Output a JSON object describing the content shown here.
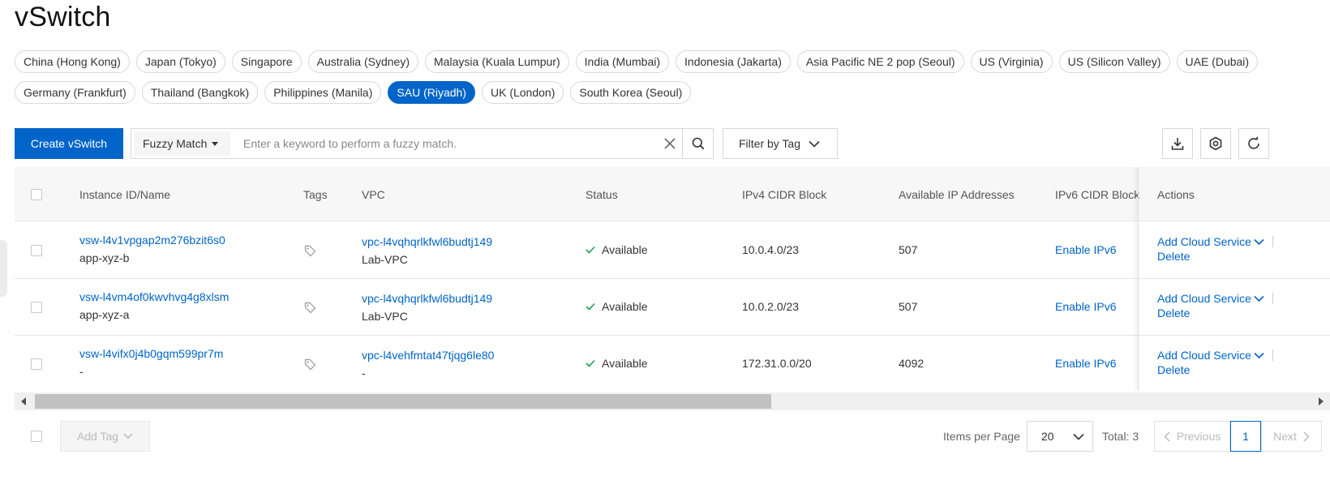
{
  "page": {
    "title": "vSwitch"
  },
  "regions": [
    {
      "label": "China (Hong Kong)",
      "active": false
    },
    {
      "label": "Japan (Tokyo)",
      "active": false
    },
    {
      "label": "Singapore",
      "active": false
    },
    {
      "label": "Australia (Sydney)",
      "active": false
    },
    {
      "label": "Malaysia (Kuala Lumpur)",
      "active": false
    },
    {
      "label": "India (Mumbai)",
      "active": false
    },
    {
      "label": "Indonesia (Jakarta)",
      "active": false
    },
    {
      "label": "Asia Pacific NE 2 pop (Seoul)",
      "active": false
    },
    {
      "label": "US (Virginia)",
      "active": false
    },
    {
      "label": "US (Silicon Valley)",
      "active": false
    },
    {
      "label": "UAE (Dubai)",
      "active": false
    },
    {
      "label": "Germany (Frankfurt)",
      "active": false
    },
    {
      "label": "Thailand (Bangkok)",
      "active": false
    },
    {
      "label": "Philippines (Manila)",
      "active": false
    },
    {
      "label": "SAU (Riyadh)",
      "active": true
    },
    {
      "label": "UK (London)",
      "active": false
    },
    {
      "label": "South Korea (Seoul)",
      "active": false
    }
  ],
  "toolbar": {
    "create_label": "Create vSwitch",
    "match_mode": "Fuzzy Match",
    "search_placeholder": "Enter a keyword to perform a fuzzy match.",
    "filter_tag_label": "Filter by Tag"
  },
  "table": {
    "headers": {
      "instance": "Instance ID/Name",
      "tags": "Tags",
      "vpc": "VPC",
      "status": "Status",
      "ipv4": "IPv4 CIDR Block",
      "available_ips": "Available IP Addresses",
      "ipv6": "IPv6 CIDR Block",
      "actions": "Actions"
    },
    "rows": [
      {
        "id": "vsw-l4v1vpgap2m276bzit6s0",
        "name": "app-xyz-b",
        "vpc_id": "vpc-l4vqhqrlkfwl6budtj149",
        "vpc_name": "Lab-VPC",
        "status": "Available",
        "ipv4": "10.0.4.0/23",
        "available": "507",
        "ipv6": "Enable IPv6",
        "action_add": "Add Cloud Service",
        "action_delete": "Delete"
      },
      {
        "id": "vsw-l4vm4of0kwvhvg4g8xlsm",
        "name": "app-xyz-a",
        "vpc_id": "vpc-l4vqhqrlkfwl6budtj149",
        "vpc_name": "Lab-VPC",
        "status": "Available",
        "ipv4": "10.0.2.0/23",
        "available": "507",
        "ipv6": "Enable IPv6",
        "action_add": "Add Cloud Service",
        "action_delete": "Delete"
      },
      {
        "id": "vsw-l4vifx0j4b0gqm599pr7m",
        "name": "-",
        "vpc_id": "vpc-l4vehfmtat47tjqg6le80",
        "vpc_name": "-",
        "status": "Available",
        "ipv4": "172.31.0.0/20",
        "available": "4092",
        "ipv6": "Enable IPv6",
        "action_add": "Add Cloud Service",
        "action_delete": "Delete"
      }
    ]
  },
  "footer": {
    "add_tag_label": "Add Tag",
    "items_per_page_label": "Items per Page",
    "page_size": "20",
    "total_label": "Total: 3",
    "prev_label": "Previous",
    "current_page": "1",
    "next_label": "Next"
  },
  "colors": {
    "accent": "#0064c8",
    "success": "#1e9e52"
  }
}
